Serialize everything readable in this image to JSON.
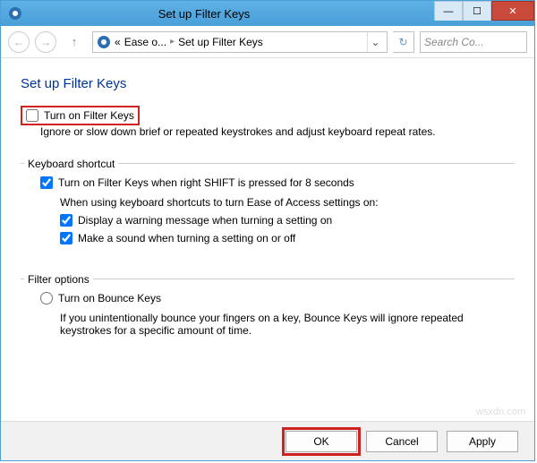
{
  "window": {
    "title": "Set up Filter Keys"
  },
  "nav": {
    "crumb1": "Ease o...",
    "crumb2": "Set up Filter Keys",
    "search_placeholder": "Search Co..."
  },
  "page": {
    "heading": "Set up Filter Keys",
    "turn_on_label": "Turn on Filter Keys",
    "turn_on_desc": "Ignore or slow down brief or repeated keystrokes and adjust keyboard repeat rates."
  },
  "keyboard_shortcut": {
    "legend": "Keyboard shortcut",
    "shift_label": "Turn on Filter Keys when right SHIFT is pressed for 8 seconds",
    "sub_intro": "When using keyboard shortcuts to turn Ease of Access settings on:",
    "warn_label": "Display a warning message when turning a setting on",
    "sound_label": "Make a sound when turning a setting on or off"
  },
  "filter_options": {
    "legend": "Filter options",
    "bounce_label": "Turn on Bounce Keys",
    "bounce_desc": "If you unintentionally bounce your fingers on a key, Bounce Keys will ignore repeated keystrokes for a specific amount of time."
  },
  "buttons": {
    "ok": "OK",
    "cancel": "Cancel",
    "apply": "Apply"
  },
  "watermark": "wsxdn.com"
}
